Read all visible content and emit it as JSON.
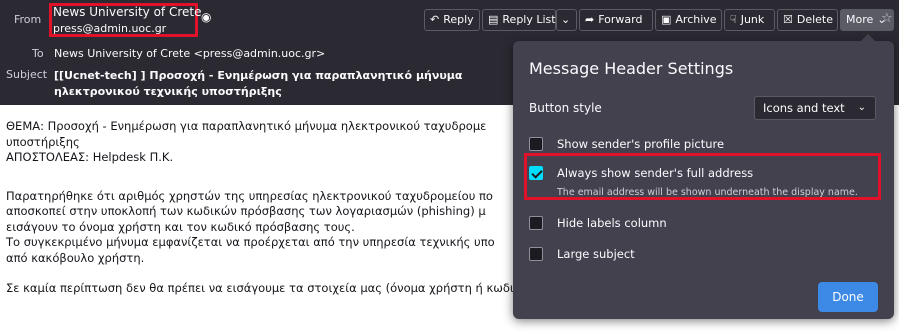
{
  "header": {
    "from_label": "From",
    "from_name": "News University of Crete",
    "from_address": "press@admin.uoc.gr",
    "to_label": "To",
    "to_value": "News University of Crete <press@admin.uoc.gr>",
    "subject_label": "Subject",
    "subject_value": "[[Ucnet-tech] ] Προσοχή - Ενημέρωση για παραπλανητικό μήνυμα ηλεκτρονικού τεχνικής υποστήριξης"
  },
  "toolbar": {
    "reply": "Reply",
    "reply_list": "Reply List",
    "forward": "Forward",
    "archive": "Archive",
    "junk": "Junk",
    "delete": "Delete",
    "more": "More"
  },
  "body": {
    "line1": "ΘΕΜΑ: Προσοχή -  Ενημέρωση για παραπλανητικό μήνυμα ηλεκτρονικού ταχυδρομε",
    "line2": "υποστήριξης",
    "line3": "ΑΠΟΣΤΟΛΕΑΣ: Helpdesk Π.Κ.",
    "line4": "Παρατηρήθηκε ότι αριθμός χρηστών της υπηρεσίας ηλεκτρονικού ταχυδρομείου πο",
    "line5": "αποσκοπεί στην υποκλοπή των κωδικών πρόσβασης των λογαριασμών (phishing) μ",
    "line6": "εισάγουν το όνομα  χρήστη και τον κωδικό πρόσβασης τους.",
    "line7": "Το συγκεκριμένο μήνυμα εμφανίζεται να προέρχεται από την υπηρεσία τεχνικής υπο",
    "line8": "από κακόβουλο χρήστη.",
    "line9": "Σε καμία περίπτωση δεν θα πρέπει να εισάγουμε τα στοιχεία μας (όνομα  χρήστη ή κωδικό πρόσβασης) στην ιστοσελίδα για την οποία  αναφέρει"
  },
  "popup": {
    "title": "Message Header Settings",
    "button_style_label": "Button style",
    "button_style_value": "Icons and text",
    "options": [
      {
        "label": "Show sender's profile picture",
        "checked": false
      },
      {
        "label": "Always show sender's full address",
        "checked": true,
        "description": "The email address will be shown underneath the display name."
      },
      {
        "label": "Hide labels column",
        "checked": false
      },
      {
        "label": "Large subject",
        "checked": false
      }
    ],
    "done": "Done"
  },
  "colors": {
    "header_bg": "#2b2a33",
    "popup_bg": "#42414d",
    "accent": "#00ddff",
    "done_button": "#3d8ae6",
    "highlight": "#e0122a"
  }
}
